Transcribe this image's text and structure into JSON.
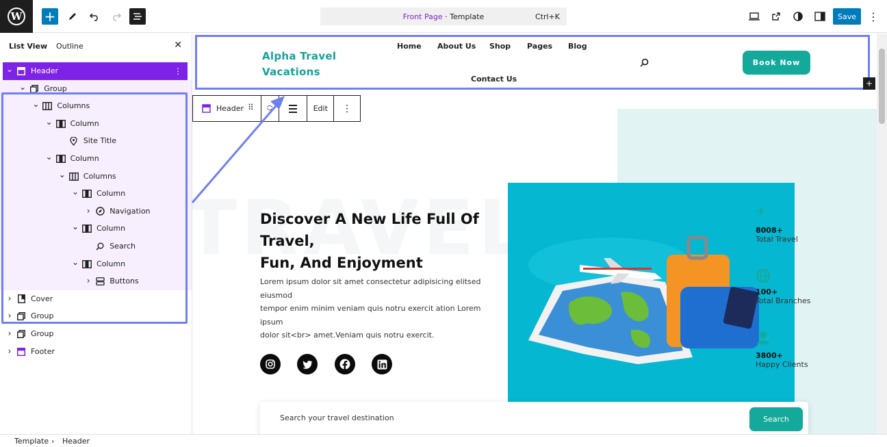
{
  "topbar": {
    "doc_title_page": "Front Page",
    "doc_title_sep": " · Template",
    "shortcut": "Ctrl+K",
    "save_label": "Save"
  },
  "sidebar": {
    "tab_list": "List View",
    "tab_outline": "Outline",
    "close_glyph": "✕",
    "items": [
      {
        "label": "Header",
        "level": 0,
        "icon": "template-part-icon"
      },
      {
        "label": "Group",
        "level": 1,
        "icon": "group-icon"
      },
      {
        "label": "Columns",
        "level": 2,
        "icon": "columns-icon"
      },
      {
        "label": "Column",
        "level": 3,
        "icon": "column-icon"
      },
      {
        "label": "Site Title",
        "level": 4,
        "icon": "map-pin-icon"
      },
      {
        "label": "Column",
        "level": 3,
        "icon": "column-icon"
      },
      {
        "label": "Columns",
        "level": 4,
        "icon": "columns-icon"
      },
      {
        "label": "Column",
        "level": 5,
        "icon": "column-icon"
      },
      {
        "label": "Navigation",
        "level": 6,
        "icon": "navigation-icon"
      },
      {
        "label": "Column",
        "level": 5,
        "icon": "column-icon"
      },
      {
        "label": "Search",
        "level": 6,
        "icon": "search-icon"
      },
      {
        "label": "Column",
        "level": 5,
        "icon": "column-icon"
      },
      {
        "label": "Buttons",
        "level": 6,
        "icon": "buttons-icon"
      },
      {
        "label": "Cover",
        "level": 0,
        "icon": "cover-icon"
      },
      {
        "label": "Group",
        "level": 0,
        "icon": "group-icon"
      },
      {
        "label": "Group",
        "level": 0,
        "icon": "group-icon"
      },
      {
        "label": "Footer",
        "level": 0,
        "icon": "template-part-icon"
      }
    ]
  },
  "breadcrumb": {
    "root": "Template",
    "sep": "›",
    "current": "Header"
  },
  "block_toolbar": {
    "block_name": "Header",
    "edit_label": "Edit"
  },
  "site": {
    "title_line1": "Alpha Travel",
    "title_line2": "Vacations",
    "nav": [
      "Home",
      "About Us",
      "Shop",
      "Pages",
      "Blog",
      "Contact Us"
    ],
    "book_label": "Book Now",
    "hero_title_1": "Discover A New Life Full Of",
    "hero_title_2": "Travel,",
    "hero_title_3": "Fun, And Enjoyment",
    "hero_text_1": "Lorem ipsum dolor sit amet consectetur adipisicing elitsed",
    "hero_text_2": "eiusmod",
    "hero_text_3": "tempor enim minim veniam quis notru exercit ation Lorem ipsum",
    "hero_text_4": "dolor sit<br> amet.Veniam quis notru exercit.",
    "bg_word": "TRAVEL",
    "stats": [
      {
        "num": "8008+",
        "label": "Total Travel"
      },
      {
        "num": "100+",
        "label": "Total Branches"
      },
      {
        "num": "3800+",
        "label": "Happy Clients"
      }
    ],
    "search_placeholder": "Search your travel destination",
    "search_button": "Search"
  },
  "colors": {
    "accent": "#7f22e8",
    "wp_blue": "#007cba",
    "teal": "#14a99a",
    "highlight": "#6f7ff0"
  }
}
